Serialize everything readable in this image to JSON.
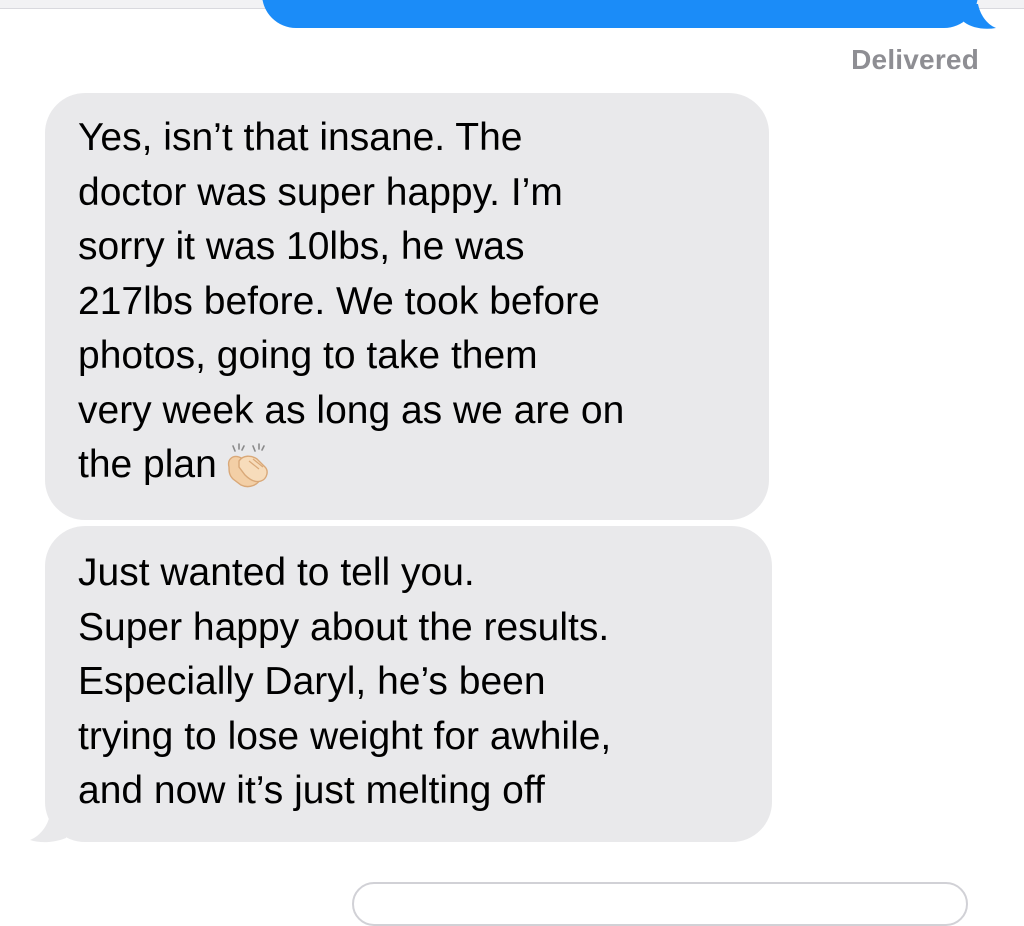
{
  "conversation": {
    "delivery_status": "Delivered",
    "messages": [
      {
        "sender": "received",
        "lines": [
          "Yes, isn’t that insane. The",
          "doctor was super happy. I’m",
          "sorry it was 10lbs, he was",
          "217lbs before. We took before",
          "photos, going to take them",
          "very week as long as we are on",
          "the plan"
        ],
        "trailing_emoji": "clapping-hands-icon"
      },
      {
        "sender": "received",
        "lines": [
          "Just wanted to tell you.",
          "Super happy about the results.",
          "Especially Daryl, he’s been",
          "trying to lose weight for awhile,",
          "and now it’s just melting off"
        ]
      }
    ]
  },
  "colors": {
    "sent_bubble": "#1b8cf8",
    "received_bubble": "#e9e9eb",
    "status_text": "#8e8e93"
  }
}
